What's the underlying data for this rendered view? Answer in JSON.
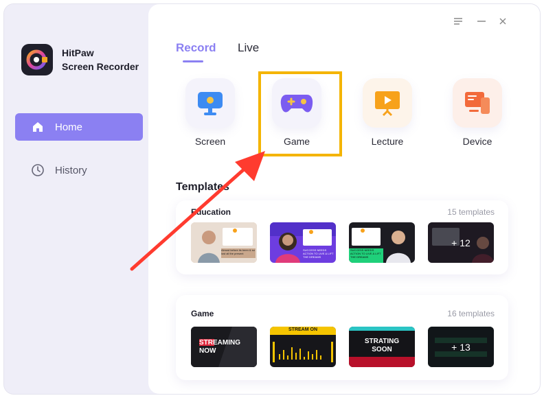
{
  "app": {
    "name_line1": "HitPaw",
    "name_line2": "Screen Recorder"
  },
  "sidebar": {
    "items": [
      {
        "label": "Home",
        "icon": "home-icon",
        "active": true
      },
      {
        "label": "History",
        "icon": "clock-icon",
        "active": false
      }
    ]
  },
  "window_controls": [
    "menu-icon",
    "minimize-icon",
    "close-icon"
  ],
  "tabs": [
    {
      "label": "Record",
      "active": true
    },
    {
      "label": "Live",
      "active": false
    }
  ],
  "modes": [
    {
      "label": "Screen",
      "icon": "monitor-icon"
    },
    {
      "label": "Game",
      "icon": "gamepad-icon",
      "highlighted": true
    },
    {
      "label": "Lecture",
      "icon": "presentation-icon"
    },
    {
      "label": "Device",
      "icon": "device-icon"
    }
  ],
  "templates": {
    "title": "Templates",
    "sections": [
      {
        "name": "Education",
        "count": "15 templates",
        "more": "+ 12",
        "thumb_texts": [
          "Almost before its been & so lost all the present",
          "SUCCESS NEEDS ACTION TO LIVE & LIFT THE DREAMS",
          "SUCCESS NEEDS ACTION TO LIVE & LIFT THE DREAMS"
        ]
      },
      {
        "name": "Game",
        "count": "16 templates",
        "more": "+ 13",
        "thumb_texts": [
          "STREAMING NOW",
          "STREAM ON",
          "STRATING SOON"
        ]
      }
    ]
  },
  "colors": {
    "accent": "#8b80f2",
    "highlight": "#f4b400",
    "arrow": "#ff3b2f"
  }
}
